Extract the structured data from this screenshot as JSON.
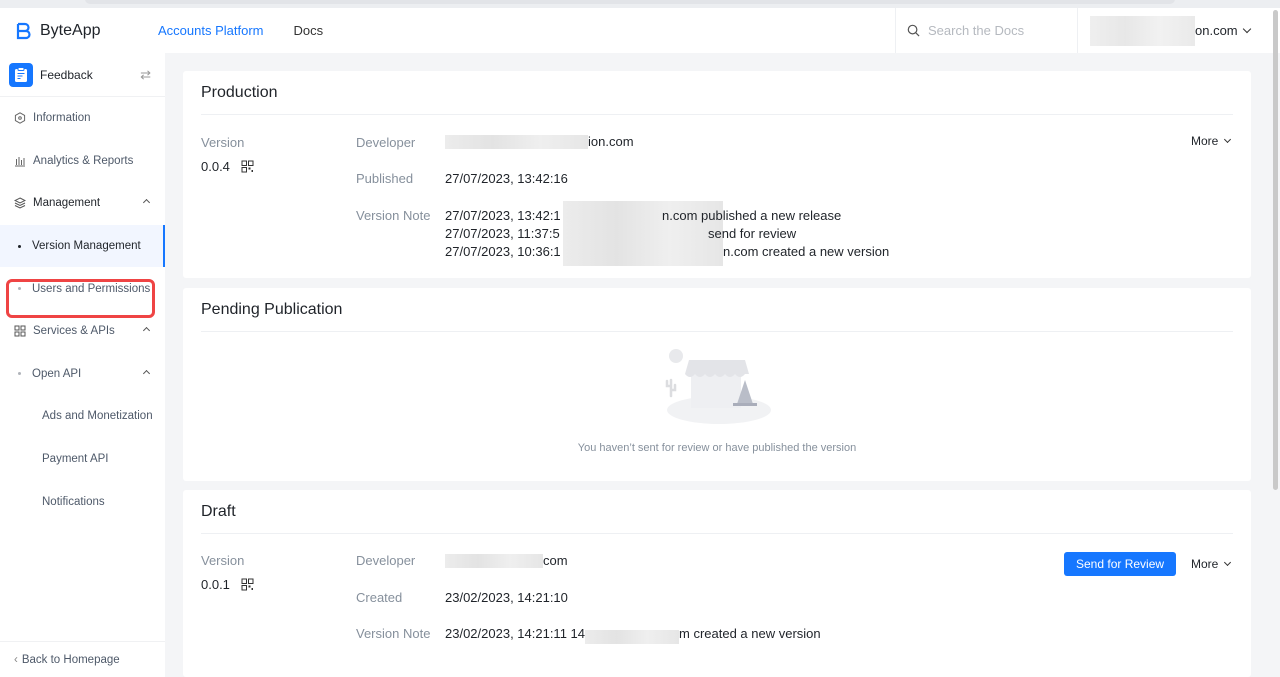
{
  "header": {
    "brand": "ByteApp",
    "nav": [
      {
        "label": "Accounts Platform",
        "active": true
      },
      {
        "label": "Docs",
        "active": false
      }
    ],
    "search_placeholder": "Search the Docs",
    "account_suffix": "on.com"
  },
  "sidebar": {
    "app_name": "Feedback",
    "items": [
      {
        "label": "Information",
        "icon": "info-hexagon-icon"
      },
      {
        "label": "Analytics & Reports",
        "icon": "bar-chart-icon"
      },
      {
        "label": "Management",
        "icon": "layers-icon",
        "expanded": true
      },
      {
        "label": "Version Management",
        "selected": true
      },
      {
        "label": "Users and Permissions"
      },
      {
        "label": "Services & APIs",
        "icon": "grid-icon",
        "expanded": true
      },
      {
        "label": "Open API",
        "expanded": true
      },
      {
        "label": "Ads and Monetization"
      },
      {
        "label": "Payment API"
      },
      {
        "label": "Notifications"
      }
    ],
    "back_label": "Back to Homepage"
  },
  "production": {
    "title": "Production",
    "version_label": "Version",
    "version": "0.0.4",
    "developer_label": "Developer",
    "developer_suffix": "ion.com",
    "published_label": "Published",
    "published": "27/07/2023, 13:42:16",
    "note_label": "Version Note",
    "notes": [
      {
        "prefix": "27/07/2023, 13:42:1",
        "suffix": "n.com published a new release"
      },
      {
        "prefix": "27/07/2023, 11:37:5",
        "suffix": "send for review"
      },
      {
        "prefix": "27/07/2023, 10:36:1",
        "suffix": "n.com created a new version"
      }
    ],
    "more_label": "More"
  },
  "pending": {
    "title": "Pending Publication",
    "empty_text": "You haven’t sent for review or have published the version"
  },
  "draft": {
    "title": "Draft",
    "version_label": "Version",
    "version": "0.0.1",
    "developer_label": "Developer",
    "developer_suffix": "com",
    "created_label": "Created",
    "created": "23/02/2023, 14:21:10",
    "note_label": "Version Note",
    "note_prefix": "23/02/2023, 14:21:11 14",
    "note_suffix": "m created a new version",
    "send_review_label": "Send for Review",
    "more_label": "More"
  }
}
